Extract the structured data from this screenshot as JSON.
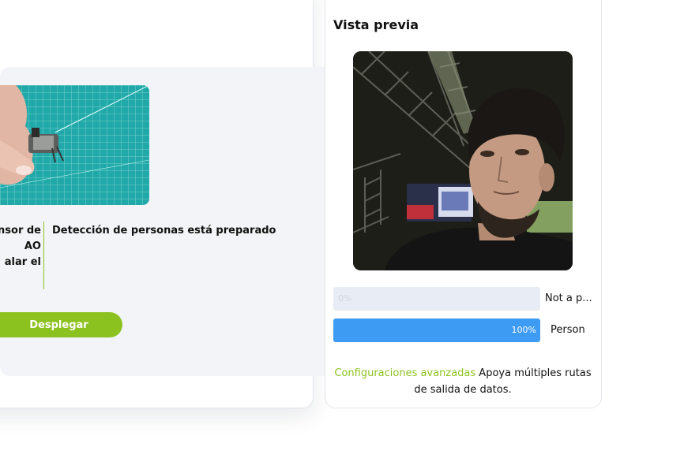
{
  "left_panel": {
    "step_lines": [
      "nsor de",
      "AO",
      "alar el"
    ],
    "status_text": "Detección de personas está preparado",
    "deploy_label": "Desplegar"
  },
  "preview": {
    "title": "Vista previa",
    "results": [
      {
        "label": "Not a p...",
        "percent_text": "0%",
        "value": 0.0
      },
      {
        "label": "Person",
        "percent_text": "100%",
        "value": 1.0
      }
    ],
    "advanced_link": "Configuraciones avanzadas",
    "advanced_text": "Apoya múltiples rutas de salida de datos.",
    "colors": {
      "accent": "#8cc21f",
      "bar": "#3d9bf3",
      "bar_track": "#e8ecf5"
    }
  }
}
